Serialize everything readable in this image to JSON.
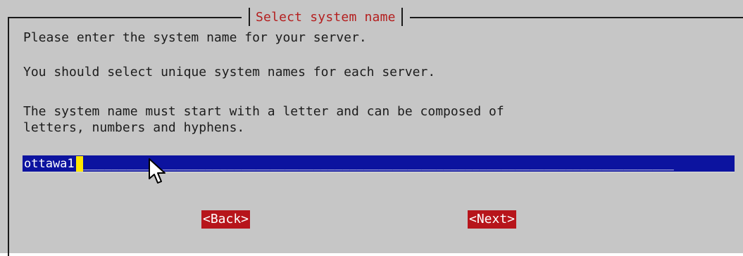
{
  "dialog": {
    "title": "Select system name",
    "line1": "Please enter the system name for your server.",
    "line2": "You should select unique system names for each server.",
    "line3": "The system name must start with a letter and can be composed of",
    "line4": "letters, numbers and hyphens."
  },
  "input": {
    "value": "ottawa1",
    "fill": "__________________________________________________________________________________"
  },
  "buttons": {
    "back": "<Back>",
    "next": "<Next>"
  },
  "colors": {
    "background": "#c6c6c6",
    "title": "#b41f1f",
    "input_bg": "#0c139f",
    "cursor": "#ffe600",
    "button_bg": "#b7151b"
  },
  "icons": {
    "mouse_pointer": "arrow-pointer"
  }
}
